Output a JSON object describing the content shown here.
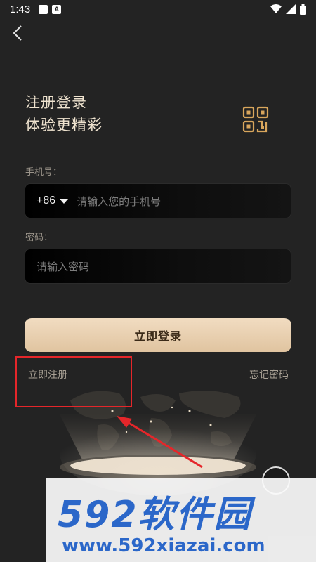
{
  "status_bar": {
    "time": "1:43",
    "a_icon_letter": "A"
  },
  "header": {
    "title_line1": "注册登录",
    "title_line2": "体验更精彩"
  },
  "phone": {
    "label": "手机号：",
    "country_code": "+86",
    "placeholder": "请输入您的手机号"
  },
  "password": {
    "label": "密码：",
    "placeholder": "请输入密码"
  },
  "actions": {
    "login_label": "立即登录",
    "register_label": "立即注册",
    "forgot_label": "忘记密码"
  },
  "watermark": {
    "brand": "592软件园",
    "url": "www.592xiazai.com"
  },
  "colors": {
    "accent_gold": "#e0c4a0",
    "highlight_red": "#e5262a",
    "watermark_blue": "#2b67c9"
  },
  "icons": [
    "back-arrow-icon",
    "qr-code-icon",
    "wifi-icon",
    "signal-icon",
    "battery-icon",
    "caret-down-icon"
  ]
}
